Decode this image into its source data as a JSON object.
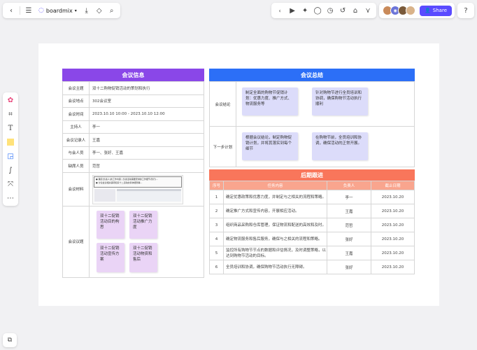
{
  "app": {
    "brand": "boardmix",
    "share_label": "Share"
  },
  "colors": {
    "purple_header": "#8a47e8",
    "blue_header": "#2c6ff7",
    "orange_header": "#f9765b",
    "share": "#5a4bff"
  },
  "meeting_info": {
    "title": "会议信息",
    "rows": [
      {
        "label": "会议主题",
        "value": "双十二购物促销活动的策划和执行"
      },
      {
        "label": "会议地点",
        "value": "302会议室"
      },
      {
        "label": "会议时间",
        "value": "2023.10.10 10:00 - 2023.10.10 12:00"
      },
      {
        "label": "主持人",
        "value": "李一"
      },
      {
        "label": "会议记录人",
        "value": "王嘉"
      },
      {
        "label": "与会人员",
        "value": "李一、张好、王嘉"
      },
      {
        "label": "缺席人员",
        "value": "范哲"
      }
    ],
    "materials_label": "会议材料",
    "materials_lines": [
      "● 确定(负责人)的工作内容 | 负责活动需要安排的工作细节(暂行)...",
      "● 讨论会议相关事项和双十二活动的具体细则等..."
    ],
    "agenda_label": "会议议题",
    "agenda_notes": [
      "双十二促销活动目的构思",
      "双十二促销活动推广力度",
      "双十二促销活动宣传方案",
      "双十二促销活动物资和售后"
    ]
  },
  "meeting_summary": {
    "title": "会议总结",
    "conclusion_label": "会议结论",
    "conclusion_notes": [
      "制定全面的购物节促销计划：优惠力度、推广方式、物流服务等",
      "针对购物节进行全员培训和协调，确保购物节活动执行顺利"
    ],
    "next_label": "下一步计划",
    "next_notes": [
      "根据会议结论，制定购物促销计划，并将其落实到每个细节",
      "在购物节前，全员培训和协调，确保活动的正常开展。"
    ]
  },
  "follow_up": {
    "title": "后期跟进",
    "columns": [
      "序号",
      "任务内容",
      "负责人",
      "截止日期"
    ],
    "rows": [
      {
        "no": "1",
        "task": "确定优惠政策和优惠力度，并制定与之相关的流程和策略。",
        "owner": "李一",
        "due": "2023.10.20"
      },
      {
        "no": "2",
        "task": "确定推广方式和宣传内容，开展相应活动。",
        "owner": "王嘉",
        "due": "2023.10.20"
      },
      {
        "no": "3",
        "task": "组织商品采购和仓库管理，保证物流和配送的高效和及时。",
        "owner": "范哲",
        "due": "2023.10.20"
      },
      {
        "no": "4",
        "task": "确定物流服务和售后服务，确保与之相关的流程和策略。",
        "owner": "张好",
        "due": "2023.10.20"
      },
      {
        "no": "5",
        "task": "监控所有购物节节点的数据和评估情况，及时调整策略，以达到购物节活动的目标。",
        "owner": "王嘉",
        "due": "2023.10.20"
      },
      {
        "no": "6",
        "task": "全员培训和协调，确保购物节活动执行无障碍。",
        "owner": "张好",
        "due": "2023.10.20"
      }
    ]
  }
}
